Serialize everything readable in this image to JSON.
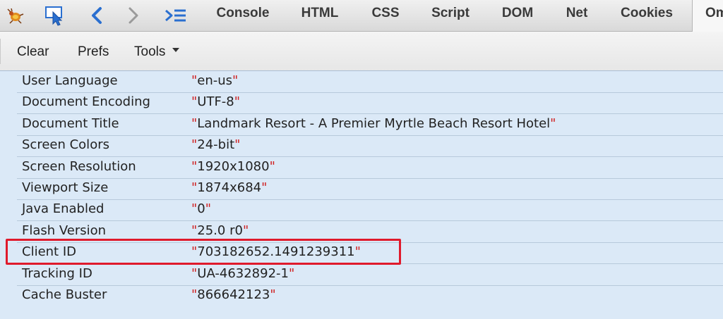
{
  "tabs": [
    {
      "label": "Console"
    },
    {
      "label": "HTML"
    },
    {
      "label": "CSS"
    },
    {
      "label": "Script"
    },
    {
      "label": "DOM"
    },
    {
      "label": "Net"
    },
    {
      "label": "Cookies"
    },
    {
      "label": "Om"
    }
  ],
  "toolbar": {
    "clear": "Clear",
    "prefs": "Prefs",
    "tools": "Tools"
  },
  "properties": [
    {
      "key": "User Language",
      "value": "en-us"
    },
    {
      "key": "Document Encoding",
      "value": "UTF-8"
    },
    {
      "key": "Document Title",
      "value": "Landmark Resort - A Premier Myrtle Beach Resort Hotel"
    },
    {
      "key": "Screen Colors",
      "value": "24-bit"
    },
    {
      "key": "Screen Resolution",
      "value": "1920x1080"
    },
    {
      "key": "Viewport Size",
      "value": "1874x684"
    },
    {
      "key": "Java Enabled",
      "value": "0"
    },
    {
      "key": "Flash Version",
      "value": "25.0 r0"
    },
    {
      "key": "Client ID",
      "value": "703182652.1491239311"
    },
    {
      "key": "Tracking ID",
      "value": "UA-4632892-1"
    },
    {
      "key": "Cache Buster",
      "value": "866642123"
    }
  ],
  "colors": {
    "highlight": "#e01a2c",
    "quote": "#d02020",
    "panel": "#dbe9f7",
    "icon_blue": "#2a6fd0"
  }
}
